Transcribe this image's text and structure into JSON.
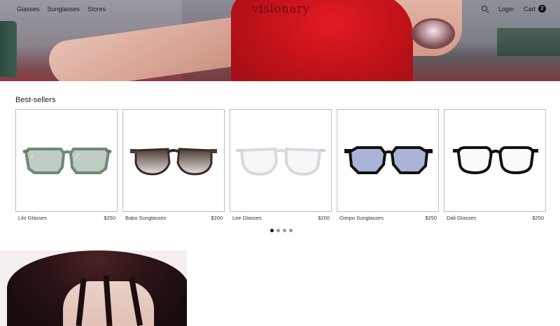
{
  "nav": {
    "links": [
      "Glasses",
      "Sunglasses",
      "Stores"
    ],
    "logo": "visionary",
    "login": "Login",
    "cart": "Cart",
    "cart_count": "2",
    "search_icon": "search-icon"
  },
  "best_sellers": {
    "title": "Best-sellers",
    "products": [
      {
        "name": "Lilo Glasses",
        "price": "$250"
      },
      {
        "name": "Babo Sunglasses",
        "price": "$200"
      },
      {
        "name": "Lee Glasses",
        "price": "$200"
      },
      {
        "name": "Gimpo Sunglasses",
        "price": "$250"
      },
      {
        "name": "Dali Glasses",
        "price": "$250"
      }
    ],
    "carousel": {
      "pages": 4,
      "active": 1
    }
  },
  "colors": {
    "logo": "#6d0d12",
    "frame_green": "#7f9a86",
    "frame_tortoise": "#3b2a24",
    "frame_clear": "#e4e6e8",
    "frame_black": "#111111"
  }
}
